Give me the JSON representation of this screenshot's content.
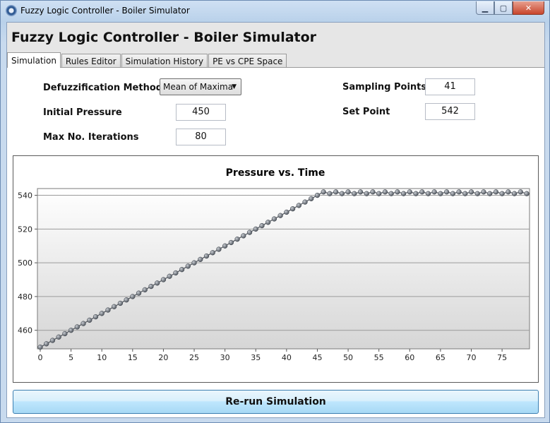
{
  "window": {
    "title": "Fuzzy Logic Controller - Boiler Simulator",
    "min_glyph": "▁",
    "max_glyph": "▢",
    "close_glyph": "✕"
  },
  "app": {
    "heading": "Fuzzy Logic Controller - Boiler Simulator"
  },
  "tabs": [
    {
      "label": "Simulation",
      "active": true
    },
    {
      "label": "Rules Editor",
      "active": false
    },
    {
      "label": "Simulation History",
      "active": false
    },
    {
      "label": "PE vs CPE Space",
      "active": false
    }
  ],
  "form": {
    "defuzz_label": "Defuzzification Method",
    "defuzz_value": "Mean of Maxima",
    "initial_pressure_label": "Initial Pressure",
    "initial_pressure_value": "450",
    "max_iter_label": "Max No. Iterations",
    "max_iter_value": "80",
    "sampling_points_label": "Sampling Points",
    "sampling_points_value": "41",
    "set_point_label": "Set Point",
    "set_point_value": "542"
  },
  "rerun_label": "Re-run Simulation",
  "colors": {
    "marker": "#6b737d",
    "line": "#4a4f57",
    "grid": "#9a9a9a"
  },
  "chart_data": {
    "type": "line",
    "title": "Pressure vs. Time",
    "xlabel": "",
    "ylabel": "",
    "xlim": [
      0,
      79
    ],
    "ylim": [
      449,
      544
    ],
    "xticks": [
      0,
      5,
      10,
      15,
      20,
      25,
      30,
      35,
      40,
      45,
      50,
      55,
      60,
      65,
      70,
      75
    ],
    "yticks": [
      460,
      480,
      500,
      520,
      540
    ],
    "series": [
      {
        "x": [
          0,
          1,
          2,
          3,
          4,
          5,
          6,
          7,
          8,
          9,
          10,
          11,
          12,
          13,
          14,
          15,
          16,
          17,
          18,
          19,
          20,
          21,
          22,
          23,
          24,
          25,
          26,
          27,
          28,
          29,
          30,
          31,
          32,
          33,
          34,
          35,
          36,
          37,
          38,
          39,
          40,
          41,
          42,
          43,
          44,
          45,
          46,
          47,
          48,
          49,
          50,
          51,
          52,
          53,
          54,
          55,
          56,
          57,
          58,
          59,
          60,
          61,
          62,
          63,
          64,
          65,
          66,
          67,
          68,
          69,
          70,
          71,
          72,
          73,
          74,
          75,
          76,
          77,
          78,
          79
        ],
        "y": [
          450,
          452,
          454,
          456,
          458,
          460,
          462,
          464,
          466,
          468,
          470,
          472,
          474,
          476,
          478,
          480,
          482,
          484,
          486,
          488,
          490,
          492,
          494,
          496,
          498,
          500,
          502,
          504,
          506,
          508,
          510,
          512,
          514,
          516,
          518,
          520,
          522,
          524,
          526,
          528,
          530,
          532,
          534,
          536,
          538,
          540,
          542,
          541,
          542,
          541,
          542,
          541,
          542,
          541,
          542,
          541,
          542,
          541,
          542,
          541,
          542,
          541,
          542,
          541,
          542,
          541,
          542,
          541,
          542,
          541,
          542,
          541,
          542,
          541,
          542,
          541,
          542,
          541,
          542,
          541
        ]
      }
    ]
  }
}
